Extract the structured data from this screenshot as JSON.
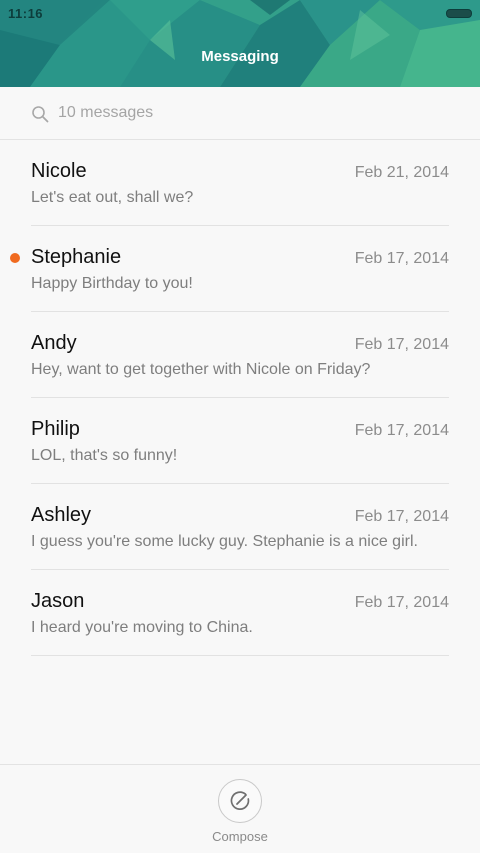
{
  "status_bar": {
    "time": "11:16",
    "battery_icon": "battery-icon"
  },
  "header": {
    "title": "Messaging"
  },
  "search": {
    "icon": "search-icon",
    "placeholder": "10 messages"
  },
  "messages": [
    {
      "name": "Nicole",
      "date": "Feb 21, 2014",
      "preview": "Let's eat out, shall we?",
      "unread": false
    },
    {
      "name": "Stephanie",
      "date": "Feb 17, 2014",
      "preview": "Happy Birthday to you!",
      "unread": true
    },
    {
      "name": "Andy",
      "date": "Feb 17, 2014",
      "preview": "Hey, want to get together with Nicole on Friday?",
      "unread": false
    },
    {
      "name": "Philip",
      "date": "Feb 17, 2014",
      "preview": "LOL, that's so funny!",
      "unread": false
    },
    {
      "name": "Ashley",
      "date": "Feb 17, 2014",
      "preview": "I guess you're some lucky guy. Stephanie is a nice girl.",
      "unread": false
    },
    {
      "name": "Jason",
      "date": "Feb 17, 2014",
      "preview": "I heard you're moving to China.",
      "unread": false
    }
  ],
  "bottom_bar": {
    "compose_label": "Compose",
    "compose_icon": "compose-icon"
  },
  "colors": {
    "unread_dot": "#f06a1f",
    "header_teal": "#2c9c8b"
  }
}
